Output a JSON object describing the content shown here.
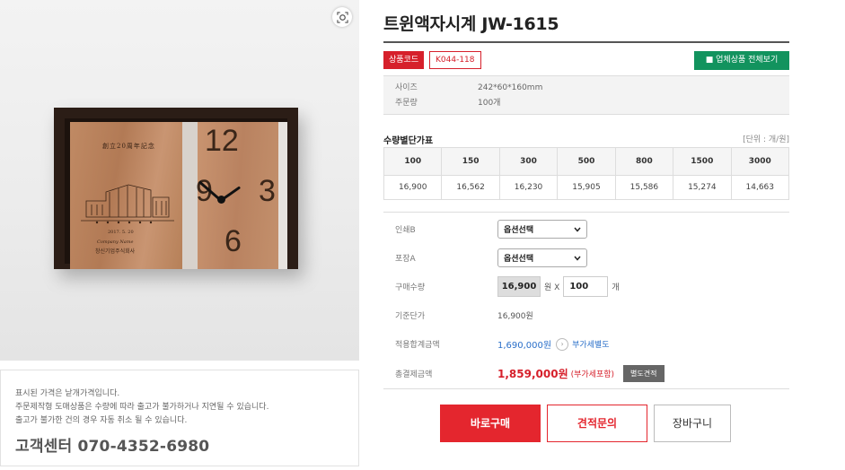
{
  "product": {
    "title": "트윈액자시계 JW-1615",
    "code_label": "상품코드",
    "code_value": "K044-118",
    "all_products_label": "■ 업체상품 전체보기"
  },
  "image": {
    "zoom_icon": "zoom-icon",
    "engraving_title": "創立20周年記念",
    "engraving_date": "2017. 5. 20",
    "engraving_company": "Company Name",
    "engraving_org": "창신기업주식회사",
    "numerals": [
      "12",
      "9",
      "3",
      "6"
    ]
  },
  "specs": [
    {
      "key": "사이즈",
      "value": "242*60*160mm"
    },
    {
      "key": "주문량",
      "value": "100개"
    }
  ],
  "quantity_prices": {
    "title": "수량별단가표",
    "unit": "[단위 : 개/원]",
    "quantities": [
      "100",
      "150",
      "300",
      "500",
      "800",
      "1500",
      "3000"
    ],
    "prices": [
      "16,900",
      "16,562",
      "16,230",
      "15,905",
      "15,586",
      "15,274",
      "14,663"
    ]
  },
  "options": {
    "print_label": "인쇄B",
    "print_value": "옵션선택",
    "pack_label": "포장A",
    "pack_value": "옵션선택",
    "qty_label": "구매수량",
    "unit_price": "16,900",
    "won_x": "원 X",
    "qty_value": "100",
    "qty_unit": "개",
    "base_label": "기준단가",
    "base_value": "16,900원",
    "applied_label": "적용합계금액",
    "applied_value": "1,690,000원",
    "applied_arrow": "›",
    "vat_separate": "부가세별도",
    "total_label": "총결제금액",
    "total_value": "1,859,000원",
    "total_note": "(부가세포함)",
    "separate_quote": "별도견적"
  },
  "buttons": {
    "buy": "바로구매",
    "quote": "견적문의",
    "cart": "장바구니"
  },
  "notice": {
    "lines": [
      "표시된 가격은 낱개가격입니다.",
      "주문제작형 도매상품은 수량에 따라 출고가 불가하거나 지연될 수 있습니다.",
      "출고가 불가한 건의 경우 자동 취소 될 수 있습니다."
    ],
    "customer_center": "고객센터 070-4352-6980"
  },
  "colors": {
    "accent_red": "#e4262e",
    "accent_green": "#12935e",
    "link_blue": "#2a6fc9"
  }
}
